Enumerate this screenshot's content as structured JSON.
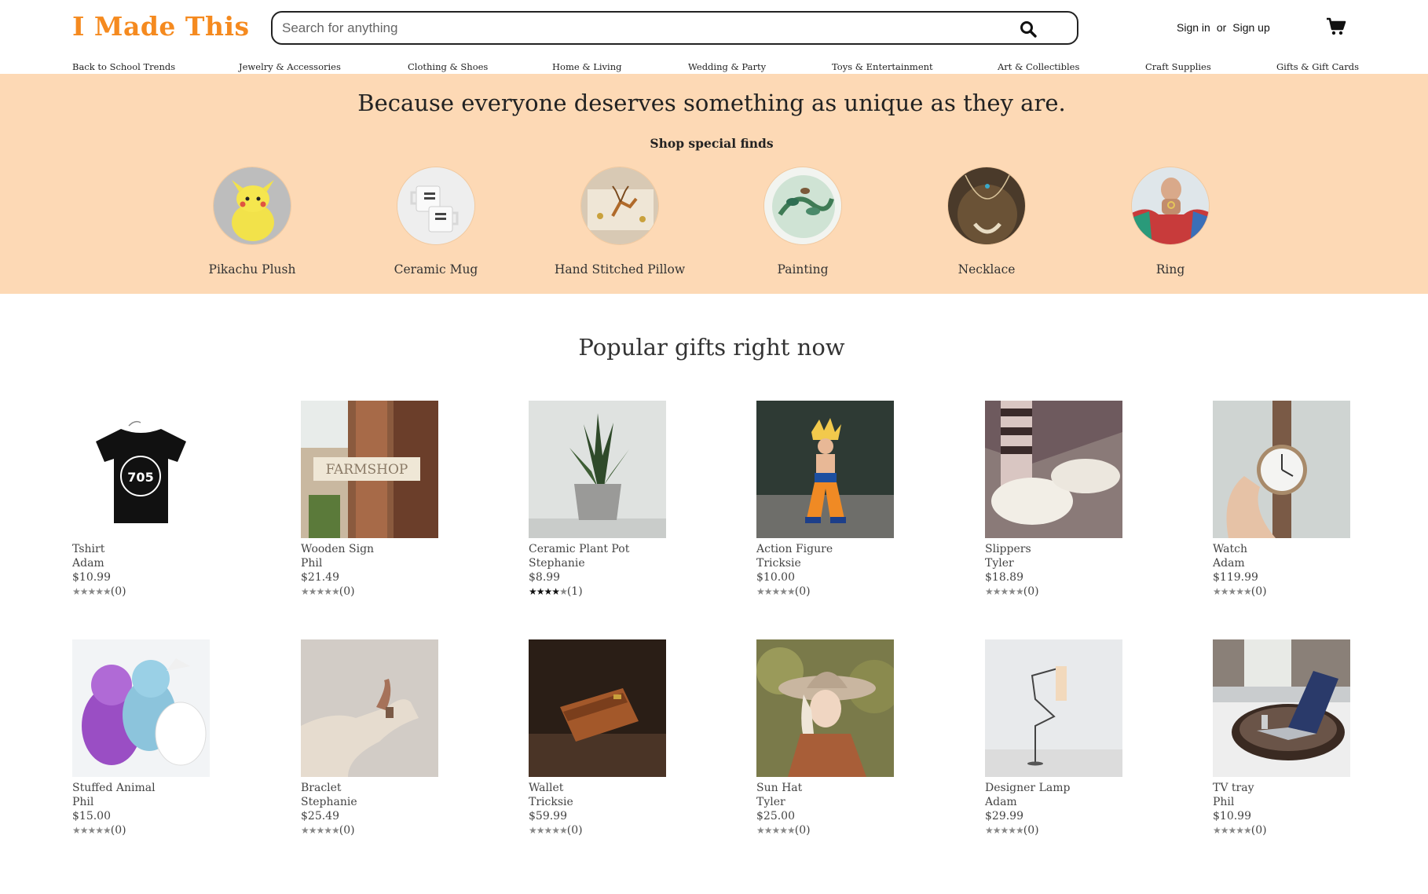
{
  "brand": {
    "name": "I Made This",
    "color": "#f58a1f"
  },
  "search": {
    "placeholder": "Search for anything",
    "value": ""
  },
  "auth": {
    "sign_in": "Sign in",
    "or": "or",
    "sign_up": "Sign up"
  },
  "nav": [
    "Back to School Trends",
    "Jewelry & Accessories",
    "Clothing & Shoes",
    "Home & Living",
    "Wedding & Party",
    "Toys & Entertainment",
    "Art & Collectibles",
    "Craft Supplies",
    "Gifts & Gift Cards"
  ],
  "hero": {
    "title": "Because everyone deserves something as unique as they are.",
    "subtitle": "Shop special finds",
    "background": "#fdd9b5",
    "finds": [
      {
        "label": "Pikachu Plush",
        "icon": "pikachu-plush-image"
      },
      {
        "label": "Ceramic Mug",
        "icon": "ceramic-mug-image"
      },
      {
        "label": "Hand Stitched Pillow",
        "icon": "pillow-image"
      },
      {
        "label": "Painting",
        "icon": "painting-image"
      },
      {
        "label": "Necklace",
        "icon": "necklace-image"
      },
      {
        "label": "Ring",
        "icon": "ring-image"
      }
    ]
  },
  "popular": {
    "title": "Popular gifts right now",
    "products": [
      {
        "name": "Tshirt",
        "seller": "Adam",
        "price": "$10.99",
        "stars": 0,
        "reviews": "(0)",
        "image": "tshirt-image"
      },
      {
        "name": "Wooden Sign",
        "seller": "Phil",
        "price": "$21.49",
        "stars": 0,
        "reviews": "(0)",
        "image": "wooden-sign-image",
        "sign_text": "FARMSHOP"
      },
      {
        "name": "Ceramic Plant Pot",
        "seller": "Stephanie",
        "price": "$8.99",
        "stars": 4,
        "reviews": "(1)",
        "image": "plant-pot-image"
      },
      {
        "name": "Action Figure",
        "seller": "Tricksie",
        "price": "$10.00",
        "stars": 0,
        "reviews": "(0)",
        "image": "action-figure-image"
      },
      {
        "name": "Slippers",
        "seller": "Tyler",
        "price": "$18.89",
        "stars": 0,
        "reviews": "(0)",
        "image": "slippers-image"
      },
      {
        "name": "Watch",
        "seller": "Adam",
        "price": "$119.99",
        "stars": 0,
        "reviews": "(0)",
        "image": "watch-image"
      },
      {
        "name": "Stuffed Animal",
        "seller": "Phil",
        "price": "$15.00",
        "stars": 0,
        "reviews": "(0)",
        "image": "stuffed-animal-image"
      },
      {
        "name": "Braclet",
        "seller": "Stephanie",
        "price": "$25.49",
        "stars": 0,
        "reviews": "(0)",
        "image": "bracelet-image"
      },
      {
        "name": "Wallet",
        "seller": "Tricksie",
        "price": "$59.99",
        "stars": 0,
        "reviews": "(0)",
        "image": "wallet-image"
      },
      {
        "name": "Sun Hat",
        "seller": "Tyler",
        "price": "$25.00",
        "stars": 0,
        "reviews": "(0)",
        "image": "sun-hat-image"
      },
      {
        "name": "Designer Lamp",
        "seller": "Adam",
        "price": "$29.99",
        "stars": 0,
        "reviews": "(0)",
        "image": "lamp-image"
      },
      {
        "name": "TV tray",
        "seller": "Phil",
        "price": "$10.99",
        "stars": 0,
        "reviews": "(0)",
        "image": "tv-tray-image"
      }
    ]
  }
}
